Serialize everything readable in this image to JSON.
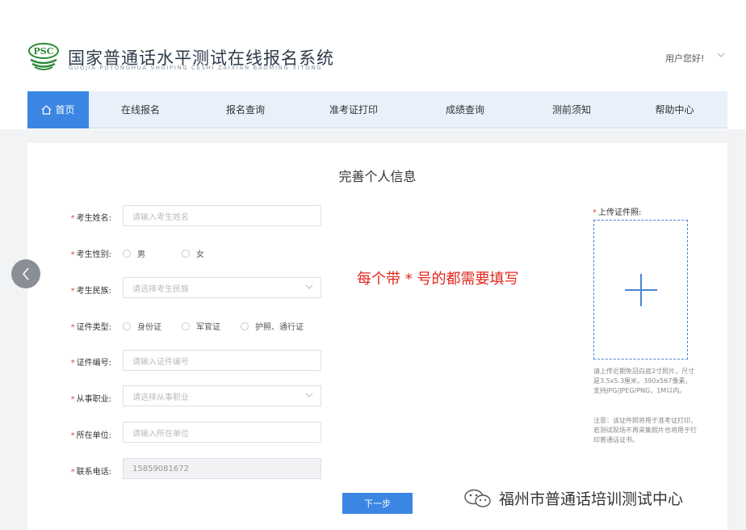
{
  "header": {
    "title": "国家普通话水平测试在线报名系统",
    "subtitle": "GUOJIA PUTONGHUA SHUIPING CESHI ZAIXIAN BAOMING XITONG",
    "logo_text": "PSC",
    "user_greeting": "用户您好!"
  },
  "nav": {
    "items": [
      {
        "label": "首页"
      },
      {
        "label": "在线报名"
      },
      {
        "label": "报名查询"
      },
      {
        "label": "准考证打印"
      },
      {
        "label": "成绩查询"
      },
      {
        "label": "测前须知"
      },
      {
        "label": "帮助中心"
      }
    ]
  },
  "form": {
    "title": "完善个人信息",
    "required_mark": "*",
    "fields": {
      "name": {
        "label": "考生姓名:",
        "placeholder": "请输入考生姓名"
      },
      "gender": {
        "label": "考生性别:",
        "options": [
          "男",
          "女"
        ]
      },
      "ethnicity": {
        "label": "考生民族:",
        "placeholder": "请选择考生民族"
      },
      "id_type": {
        "label": "证件类型:",
        "options": [
          "身份证",
          "军官证",
          "护照、通行证"
        ]
      },
      "id_number": {
        "label": "证件编号:",
        "placeholder": "请输入证件编号"
      },
      "occupation": {
        "label": "从事职业:",
        "placeholder": "请选择从事职业"
      },
      "employer": {
        "label": "所在单位:",
        "placeholder": "请输入所在单位"
      },
      "phone": {
        "label": "联系电话:",
        "value": "15859081672"
      }
    },
    "hint": "每个带 * 号的都需要填写",
    "upload": {
      "label": "上传证件照:",
      "note": "请上传近期免冠白底2寸照片，尺寸是3.5x5.3厘米，390x567像素，支持JPG/JPEG/PNG，1M以内。",
      "note2": "注意：该证件照将用于准考证打印，若测试现场不再采集照片也将用于打印普通话证书。"
    },
    "next_label": "下一步"
  },
  "watermark": {
    "text": "福州市普通话培训测试中心"
  },
  "colors": {
    "primary": "#3b86e3",
    "nav_bg": "#e8f1fa",
    "required": "#e0483d",
    "hint": "#e0281e"
  }
}
